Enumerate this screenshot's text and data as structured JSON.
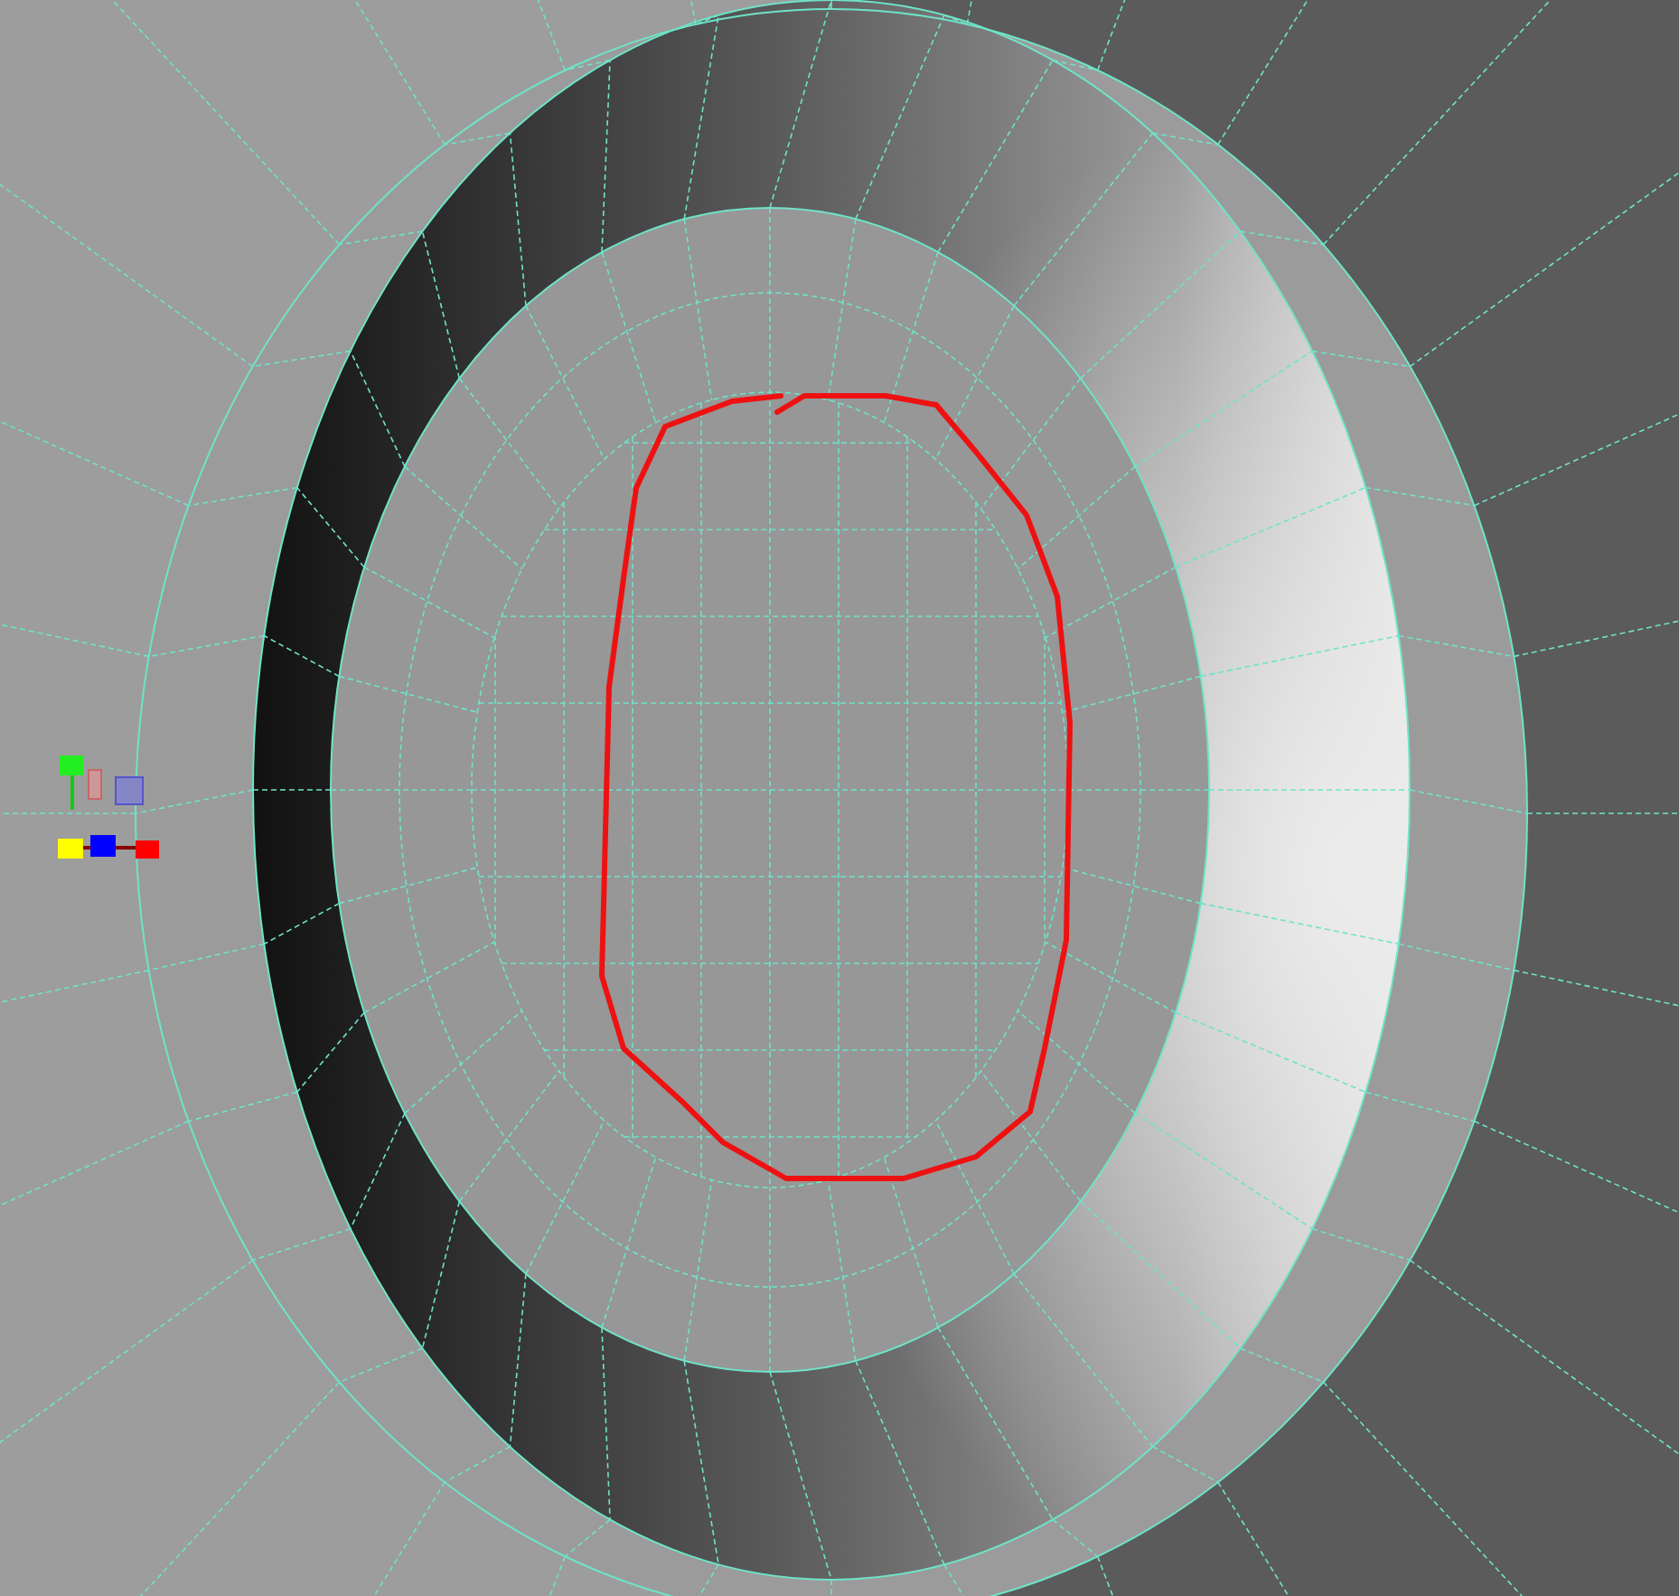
{
  "viewport": {
    "wireframe_on_shaded": true,
    "annotation_visible": true
  }
}
